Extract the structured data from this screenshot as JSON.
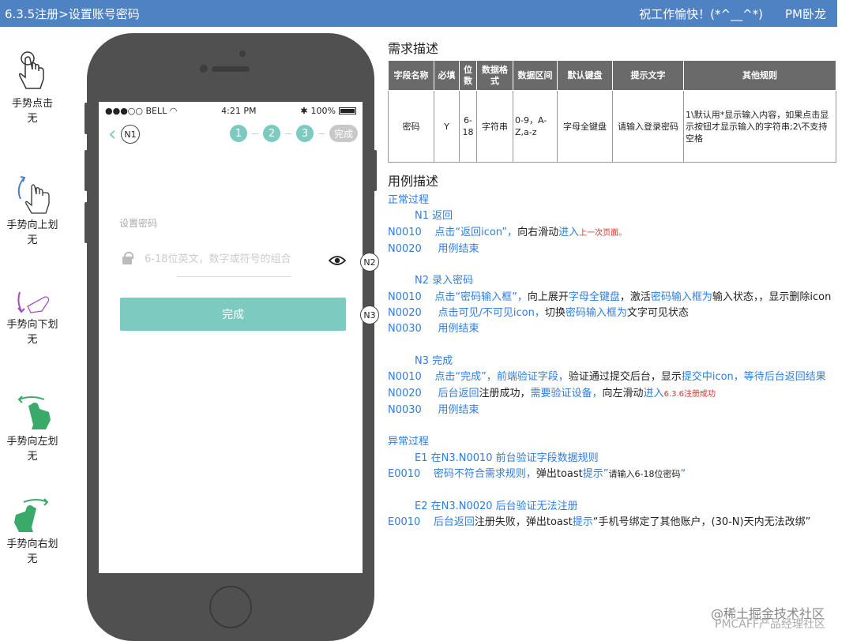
{
  "header": {
    "title": "6.3.5注册>设置账号密码",
    "slogan": "祝工作愉快！(*^__^*)",
    "author": "PM卧龙"
  },
  "gestures": [
    {
      "name": "手势点击",
      "value": "无",
      "icon": "tap-hand-icon"
    },
    {
      "name": "手势向上划",
      "value": "无",
      "icon": "swipe-up-hand-icon"
    },
    {
      "name": "手势向下划",
      "value": "无",
      "icon": "swipe-down-hand-icon"
    },
    {
      "name": "手势向左划",
      "value": "无",
      "icon": "swipe-left-hand-icon"
    },
    {
      "name": "手势向右划",
      "value": "无",
      "icon": "swipe-right-hand-icon"
    }
  ],
  "phone": {
    "status": {
      "carrier": "●●●○○ BELL",
      "time": "4:21 PM",
      "battery": "100%"
    },
    "steps": [
      "1",
      "2",
      "3"
    ],
    "step_done": "完成",
    "password_label": "设置密码",
    "password_placeholder": "6-18位英文，数字或符号的组合",
    "done_button": "完成"
  },
  "callouts": [
    "N1",
    "N2",
    "N3"
  ],
  "req": {
    "heading": "需求描述",
    "columns": [
      "字段名称",
      "必填",
      "位数",
      "数据格式",
      "数据区间",
      "默认键盘",
      "提示文字",
      "其他规则"
    ],
    "row": [
      "密码",
      "Y",
      "6-18",
      "字符串",
      "0-9，A-Z,a-z",
      "字母全键盘",
      "请输入登录密码",
      "1\\默认用*显示输入内容，如果点击显示按钮才显示输入的字符串;2\\不支持空格"
    ]
  },
  "usecase": {
    "heading": "用例描述",
    "normal": "正常过程",
    "n1": {
      "title": "N1  返回",
      "l1_code": "N0010",
      "l1_a": "点击“返回icon”，",
      "l1_b": "向右滑动",
      "l1_c": "进入",
      "l1_d": "上一次页面。",
      "l2_code": "N0020",
      "l2": "用例结束"
    },
    "n2": {
      "title": "N2  录入密码",
      "l1_code": "N0010",
      "l1_a": "点击“密码输入框”，",
      "l1_b": "向上展开",
      "l1_c": "字母全键盘",
      "l1_d": "，激活",
      "l1_e": "密码输入框为",
      "l1_f": "输入状态，，显示删除icon",
      "l2_code": "N0020",
      "l2_a": "点击可见/不可见icon，",
      "l2_b": "切换",
      "l2_c": "密码输入框为",
      "l2_d": "文字可见状态",
      "l3_code": "N0030",
      "l3": "用例结束"
    },
    "n3": {
      "title": "N3  完成",
      "l1_code": "N0010",
      "l1_a": "点击“完成”，前端验证字段，",
      "l1_b": "验证通过提交后台，显示",
      "l1_c": "提交中icon，等待后台返回结果",
      "l2_code": "N0020",
      "l2_a": "后台返回",
      "l2_b": "注册成功，",
      "l2_c": "需要验证设备，",
      "l2_d": "向左滑动",
      "l2_e": "进入",
      "l2_f": "6.3.6注册成功",
      "l3_code": "N0030",
      "l3": "用例结束"
    },
    "abnormal": "异常过程",
    "e1": {
      "title": "E1 在N3.N0010  前台验证字段数据规则",
      "code": "E0010",
      "a": "密码不符合需求规则，",
      "b": "弹出toast",
      "c": "提示”",
      "d": "请输入6-18位密码",
      "e": "“"
    },
    "e2": {
      "title": "E2 在N3.N0020  后台验证无法注册",
      "code": "E0010",
      "a": "后台返回",
      "b": "注册失败，弹出toast",
      "c": "提示",
      "d": "“手机号绑定了其他账户，(30-N)天内无法改绑”"
    }
  },
  "watermark": [
    "@稀土掘金技术社区",
    "PMCAFF产品经理社区"
  ]
}
